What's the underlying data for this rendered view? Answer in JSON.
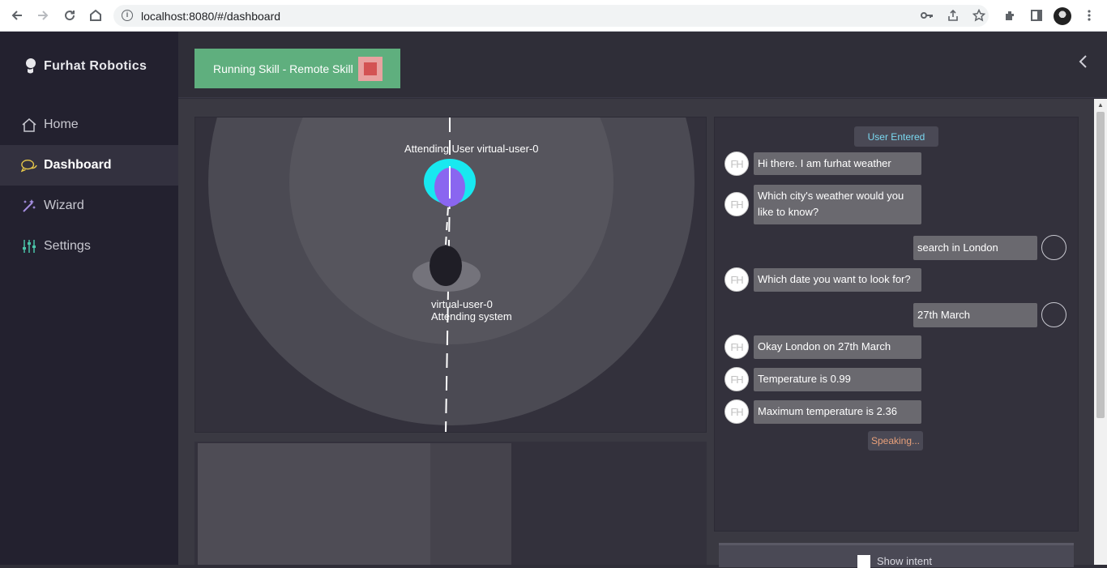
{
  "browser": {
    "url": "localhost:8080/#/dashboard"
  },
  "sidebar": {
    "brand": "Furhat Robotics",
    "items": [
      {
        "label": "Home",
        "icon": "home-icon"
      },
      {
        "label": "Dashboard",
        "icon": "chat-bubbles-icon",
        "active": true
      },
      {
        "label": "Wizard",
        "icon": "magic-wand-icon"
      },
      {
        "label": "Settings",
        "icon": "sliders-icon"
      }
    ]
  },
  "topbar": {
    "skill_status": "Running Skill - Remote Skill"
  },
  "situation": {
    "attending_label": "Attending User virtual-user-0",
    "user_name": "virtual-user-0",
    "user_status": "Attending system"
  },
  "dialog": {
    "event_badge": "User Entered",
    "avatar_initials": "FH",
    "messages": [
      {
        "from": "robot",
        "text": "Hi there. I am furhat weather"
      },
      {
        "from": "robot",
        "text": "Which city's weather would you like to know?"
      },
      {
        "from": "user",
        "text": "search in London"
      },
      {
        "from": "robot",
        "text": "Which date you want to look for?"
      },
      {
        "from": "user",
        "text": "27th March"
      },
      {
        "from": "robot",
        "text": "Okay London on 27th March"
      },
      {
        "from": "robot",
        "text": "Temperature is 0.99"
      },
      {
        "from": "robot",
        "text": "Maximum temperature is 2.36"
      }
    ],
    "status": "Speaking...",
    "show_intent_label": "Show intent"
  },
  "colors": {
    "sidebar_bg": "#23212f",
    "skill_running": "#5faf7e",
    "stop": "#d35353",
    "user_entered_text": "#7ad8f0",
    "speaking_text": "#e8a07a"
  }
}
